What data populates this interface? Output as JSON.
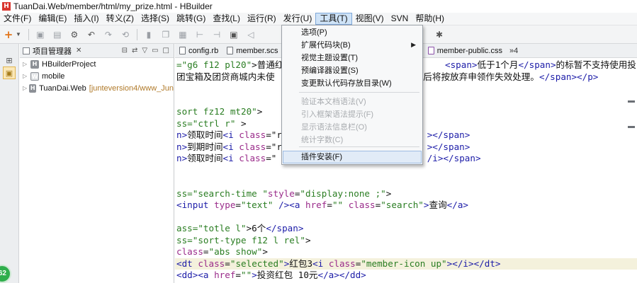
{
  "window": {
    "title": "TuanDai.Web/member/html/my_prize.html - HBuilder",
    "logo_letter": "H"
  },
  "menubar": {
    "items": [
      {
        "label": "文件(F)"
      },
      {
        "label": "编辑(E)"
      },
      {
        "label": "插入(I)"
      },
      {
        "label": "转义(Z)"
      },
      {
        "label": "选择(S)"
      },
      {
        "label": "跳转(G)"
      },
      {
        "label": "查找(L)"
      },
      {
        "label": "运行(R)"
      },
      {
        "label": "发行(U)"
      },
      {
        "label": "工具(T)",
        "active": true
      },
      {
        "label": "视图(V)"
      },
      {
        "label": "SVN"
      },
      {
        "label": "帮助(H)"
      }
    ]
  },
  "tools_menu": {
    "items": [
      {
        "label": "选项(P)",
        "enabled": true
      },
      {
        "label": "扩展代码块(B)",
        "enabled": true,
        "submenu": true
      },
      {
        "label": "视觉主题设置(T)",
        "enabled": true
      },
      {
        "label": "预编译器设置(S)",
        "enabled": true
      },
      {
        "label": "变更默认代码存放目录(W)",
        "enabled": true
      },
      {
        "label": "验证本文档语法(V)",
        "enabled": false
      },
      {
        "label": "引入框架语法提示(F)",
        "enabled": false
      },
      {
        "label": "显示语法信息栏(O)",
        "enabled": false
      },
      {
        "label": "统计字数(C)",
        "enabled": false
      },
      {
        "label": "插件安装(F)",
        "enabled": true,
        "highlighted": true
      }
    ]
  },
  "project_panel": {
    "title": "项目管理器",
    "tree": [
      {
        "label": "HBuilderProject",
        "icon": "project-icon"
      },
      {
        "label": "mobile",
        "icon": "web-project-icon"
      },
      {
        "label": "TuanDai.Web",
        "note": "[junteversion4/www_Jun",
        "icon": "project-icon"
      }
    ]
  },
  "editor": {
    "tabs": [
      {
        "label": "config.rb"
      },
      {
        "label": "member.scs"
      },
      {
        "label": "e.scss"
      },
      {
        "label": "member-public.css"
      }
    ],
    "overflow_count": "»4",
    "code_lines": [
      {
        "parts": [
          [
            "t-str",
            "=\"g6 f12 pl20\""
          ],
          [
            "t-txt",
            ">普通红"
          ],
          [
            "t-txt",
            "                              "
          ],
          [
            "t-tag",
            "<span>"
          ],
          [
            "t-txt",
            "低于1个月"
          ],
          [
            "t-tag",
            "</span>"
          ],
          [
            "t-txt",
            "的标暂不支持使用投"
          ]
        ]
      },
      {
        "parts": [
          [
            "t-txt",
            "团宝箱及团贷商城内未使"
          ],
          [
            "t-txt",
            "                          "
          ],
          [
            "t-txt",
            "日后将按放弃申领作失效处理。"
          ],
          [
            "t-tag",
            "</span></p>"
          ]
        ]
      },
      {
        "parts": [
          [
            "t-txt",
            ""
          ]
        ]
      },
      {
        "parts": [
          [
            "t-txt",
            ""
          ]
        ]
      },
      {
        "parts": [
          [
            "t-str",
            "sort fz12 mt20\""
          ],
          [
            "t-txt",
            ">"
          ]
        ]
      },
      {
        "parts": [
          [
            "t-str",
            "ss=\"ctrl r\""
          ],
          [
            "t-txt",
            " >"
          ]
        ]
      },
      {
        "parts": [
          [
            "t-tag",
            "n>"
          ],
          [
            "t-txt",
            "领取时间"
          ],
          [
            "t-tag",
            "<i "
          ],
          [
            "t-kw",
            "class"
          ],
          [
            "t-txt",
            "=\"r"
          ],
          [
            "t-txt",
            "                           "
          ],
          [
            "t-tag",
            "></span>"
          ]
        ]
      },
      {
        "parts": [
          [
            "t-tag",
            "n>"
          ],
          [
            "t-txt",
            "到期时间"
          ],
          [
            "t-tag",
            "<i "
          ],
          [
            "t-kw",
            "class"
          ],
          [
            "t-txt",
            "=\"r"
          ],
          [
            "t-txt",
            "                           "
          ],
          [
            "t-tag",
            "></span>"
          ]
        ]
      },
      {
        "parts": [
          [
            "t-tag",
            "n>"
          ],
          [
            "t-txt",
            "领取时间"
          ],
          [
            "t-tag",
            "<i "
          ],
          [
            "t-kw",
            "class"
          ],
          [
            "t-txt",
            "=\""
          ],
          [
            "t-txt",
            "                            "
          ],
          [
            "t-tag",
            "/i></span>"
          ]
        ]
      },
      {
        "parts": [
          [
            "t-txt",
            ""
          ]
        ]
      },
      {
        "parts": [
          [
            "t-txt",
            ""
          ]
        ]
      },
      {
        "parts": [
          [
            "t-str",
            "ss=\"search-time \""
          ],
          [
            "t-kw",
            "style"
          ],
          [
            "t-txt",
            "="
          ],
          [
            "t-str",
            "\"display:none ;\""
          ],
          [
            "t-txt",
            ">"
          ]
        ]
      },
      {
        "parts": [
          [
            "t-tag",
            "<input "
          ],
          [
            "t-kw",
            "type"
          ],
          [
            "t-txt",
            "="
          ],
          [
            "t-str",
            "\"text\""
          ],
          [
            "t-tag",
            " /><a "
          ],
          [
            "t-kw",
            "href"
          ],
          [
            "t-txt",
            "="
          ],
          [
            "t-str",
            "\"\""
          ],
          [
            "t-kw",
            " class"
          ],
          [
            "t-txt",
            "="
          ],
          [
            "t-str",
            "\"search\""
          ],
          [
            "t-tag",
            ">"
          ],
          [
            "t-txt",
            "查询"
          ],
          [
            "t-tag",
            "</a>"
          ]
        ]
      },
      {
        "parts": [
          [
            "t-txt",
            ""
          ]
        ]
      },
      {
        "parts": [
          [
            "t-str",
            "ass=\"totle l\""
          ],
          [
            "t-txt",
            ">6个"
          ],
          [
            "t-tag",
            "</span>"
          ]
        ]
      },
      {
        "parts": [
          [
            "t-str",
            "ss=\"sort-type f12 l rel\""
          ],
          [
            "t-txt",
            ">"
          ]
        ]
      },
      {
        "parts": [
          [
            "t-kw",
            "class"
          ],
          [
            "t-txt",
            "="
          ],
          [
            "t-str",
            "\"abs show\""
          ],
          [
            "t-txt",
            ">"
          ]
        ]
      },
      {
        "hl": true,
        "parts": [
          [
            "t-tag",
            "<dt "
          ],
          [
            "t-kw",
            "class"
          ],
          [
            "t-txt",
            "="
          ],
          [
            "t-str",
            "\"selected\""
          ],
          [
            "t-tag",
            ">"
          ],
          [
            "t-txt",
            "红包3"
          ],
          [
            "t-tag",
            "<i "
          ],
          [
            "t-kw",
            "class"
          ],
          [
            "t-txt",
            "="
          ],
          [
            "t-str",
            "\"member-icon up\""
          ],
          [
            "t-tag",
            "></i></dt>"
          ]
        ]
      },
      {
        "parts": [
          [
            "t-tag",
            "<dd><a "
          ],
          [
            "t-kw",
            "href"
          ],
          [
            "t-txt",
            "="
          ],
          [
            "t-str",
            "\"\""
          ],
          [
            "t-tag",
            ">"
          ],
          [
            "t-txt",
            "投资红包 10元"
          ],
          [
            "t-tag",
            "</a></dd>"
          ]
        ]
      }
    ]
  },
  "status": {
    "badge_text": "62"
  }
}
